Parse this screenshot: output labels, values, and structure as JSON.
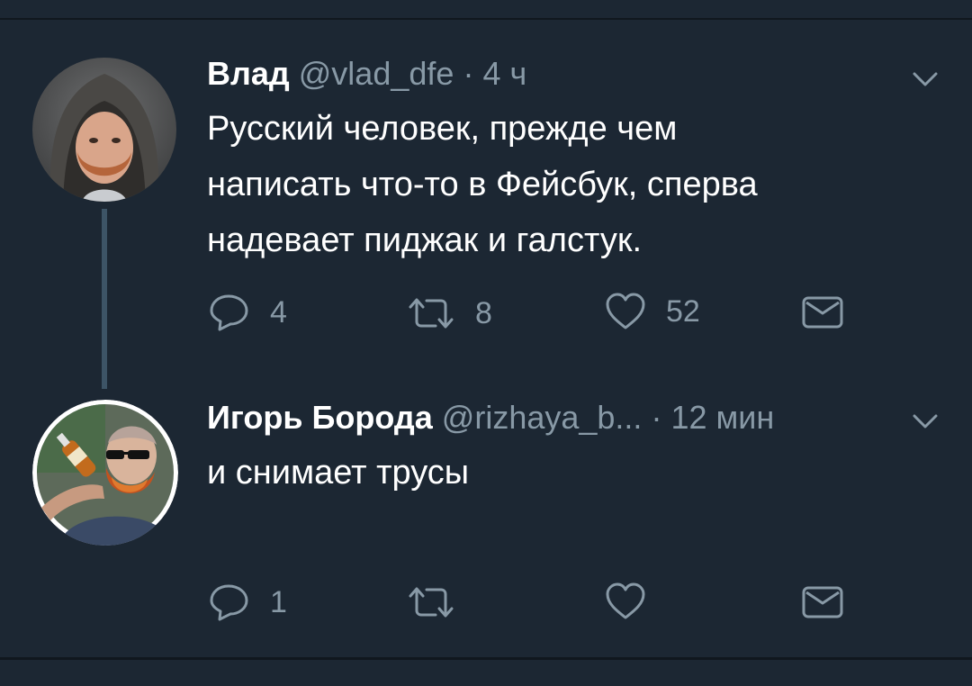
{
  "tweets": [
    {
      "name": "Влад",
      "handle": "@vlad_dfe",
      "separator": "·",
      "time": "4 ч",
      "text_lines": [
        "Русский человек, прежде чем",
        "написать что-то в Фейсбук, сперва",
        "надевает пиджак и галстук."
      ],
      "replies": "4",
      "retweets": "8",
      "likes": "52"
    },
    {
      "name": "Игорь Борода",
      "handle": "@rizhaya_b...",
      "separator": "·",
      "time": "12 мин",
      "text_lines": [
        "и снимает трусы"
      ],
      "replies": "1",
      "retweets": "",
      "likes": ""
    }
  ],
  "colors": {
    "background": "#1c2733",
    "secondary_text": "#8899a6",
    "thread_line": "#3d5466",
    "divider": "#10171e"
  },
  "icons": {
    "reply": "reply-icon",
    "retweet": "retweet-icon",
    "like": "heart-icon",
    "message": "envelope-icon",
    "menu": "chevron-down-icon"
  }
}
